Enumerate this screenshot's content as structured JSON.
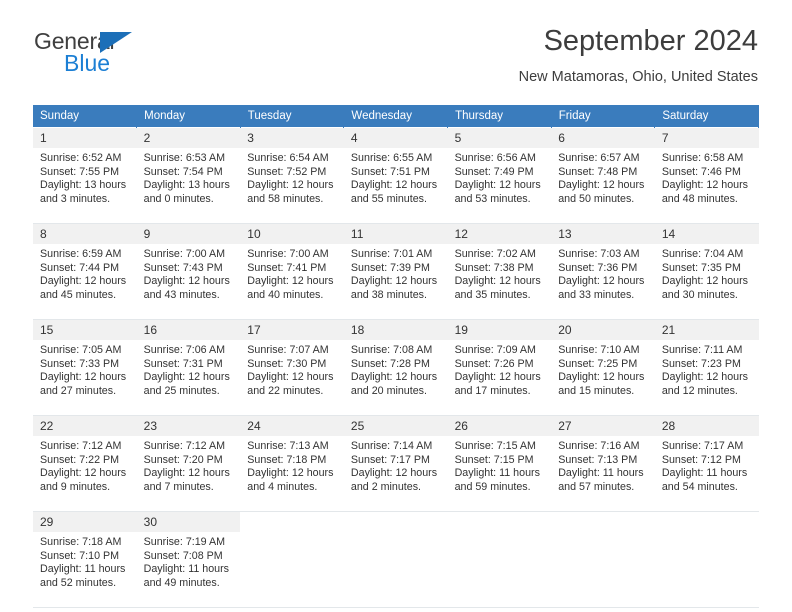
{
  "brand": {
    "name_top": "General",
    "name_bottom": "Blue",
    "accent_color": "#1c7fd4",
    "triangle_color": "#1c6fb8"
  },
  "header": {
    "title": "September 2024",
    "subtitle": "New Matamoras, Ohio, United States"
  },
  "theme": {
    "header_bg": "#3a7cbd",
    "daynum_bg": "#f1f1f1",
    "text": "#333333"
  },
  "weekdays": [
    "Sunday",
    "Monday",
    "Tuesday",
    "Wednesday",
    "Thursday",
    "Friday",
    "Saturday"
  ],
  "weeks": [
    {
      "days": [
        {
          "num": "1",
          "sunrise": "Sunrise: 6:52 AM",
          "sunset": "Sunset: 7:55 PM",
          "daylight1": "Daylight: 13 hours",
          "daylight2": "and 3 minutes."
        },
        {
          "num": "2",
          "sunrise": "Sunrise: 6:53 AM",
          "sunset": "Sunset: 7:54 PM",
          "daylight1": "Daylight: 13 hours",
          "daylight2": "and 0 minutes."
        },
        {
          "num": "3",
          "sunrise": "Sunrise: 6:54 AM",
          "sunset": "Sunset: 7:52 PM",
          "daylight1": "Daylight: 12 hours",
          "daylight2": "and 58 minutes."
        },
        {
          "num": "4",
          "sunrise": "Sunrise: 6:55 AM",
          "sunset": "Sunset: 7:51 PM",
          "daylight1": "Daylight: 12 hours",
          "daylight2": "and 55 minutes."
        },
        {
          "num": "5",
          "sunrise": "Sunrise: 6:56 AM",
          "sunset": "Sunset: 7:49 PM",
          "daylight1": "Daylight: 12 hours",
          "daylight2": "and 53 minutes."
        },
        {
          "num": "6",
          "sunrise": "Sunrise: 6:57 AM",
          "sunset": "Sunset: 7:48 PM",
          "daylight1": "Daylight: 12 hours",
          "daylight2": "and 50 minutes."
        },
        {
          "num": "7",
          "sunrise": "Sunrise: 6:58 AM",
          "sunset": "Sunset: 7:46 PM",
          "daylight1": "Daylight: 12 hours",
          "daylight2": "and 48 minutes."
        }
      ]
    },
    {
      "days": [
        {
          "num": "8",
          "sunrise": "Sunrise: 6:59 AM",
          "sunset": "Sunset: 7:44 PM",
          "daylight1": "Daylight: 12 hours",
          "daylight2": "and 45 minutes."
        },
        {
          "num": "9",
          "sunrise": "Sunrise: 7:00 AM",
          "sunset": "Sunset: 7:43 PM",
          "daylight1": "Daylight: 12 hours",
          "daylight2": "and 43 minutes."
        },
        {
          "num": "10",
          "sunrise": "Sunrise: 7:00 AM",
          "sunset": "Sunset: 7:41 PM",
          "daylight1": "Daylight: 12 hours",
          "daylight2": "and 40 minutes."
        },
        {
          "num": "11",
          "sunrise": "Sunrise: 7:01 AM",
          "sunset": "Sunset: 7:39 PM",
          "daylight1": "Daylight: 12 hours",
          "daylight2": "and 38 minutes."
        },
        {
          "num": "12",
          "sunrise": "Sunrise: 7:02 AM",
          "sunset": "Sunset: 7:38 PM",
          "daylight1": "Daylight: 12 hours",
          "daylight2": "and 35 minutes."
        },
        {
          "num": "13",
          "sunrise": "Sunrise: 7:03 AM",
          "sunset": "Sunset: 7:36 PM",
          "daylight1": "Daylight: 12 hours",
          "daylight2": "and 33 minutes."
        },
        {
          "num": "14",
          "sunrise": "Sunrise: 7:04 AM",
          "sunset": "Sunset: 7:35 PM",
          "daylight1": "Daylight: 12 hours",
          "daylight2": "and 30 minutes."
        }
      ]
    },
    {
      "days": [
        {
          "num": "15",
          "sunrise": "Sunrise: 7:05 AM",
          "sunset": "Sunset: 7:33 PM",
          "daylight1": "Daylight: 12 hours",
          "daylight2": "and 27 minutes."
        },
        {
          "num": "16",
          "sunrise": "Sunrise: 7:06 AM",
          "sunset": "Sunset: 7:31 PM",
          "daylight1": "Daylight: 12 hours",
          "daylight2": "and 25 minutes."
        },
        {
          "num": "17",
          "sunrise": "Sunrise: 7:07 AM",
          "sunset": "Sunset: 7:30 PM",
          "daylight1": "Daylight: 12 hours",
          "daylight2": "and 22 minutes."
        },
        {
          "num": "18",
          "sunrise": "Sunrise: 7:08 AM",
          "sunset": "Sunset: 7:28 PM",
          "daylight1": "Daylight: 12 hours",
          "daylight2": "and 20 minutes."
        },
        {
          "num": "19",
          "sunrise": "Sunrise: 7:09 AM",
          "sunset": "Sunset: 7:26 PM",
          "daylight1": "Daylight: 12 hours",
          "daylight2": "and 17 minutes."
        },
        {
          "num": "20",
          "sunrise": "Sunrise: 7:10 AM",
          "sunset": "Sunset: 7:25 PM",
          "daylight1": "Daylight: 12 hours",
          "daylight2": "and 15 minutes."
        },
        {
          "num": "21",
          "sunrise": "Sunrise: 7:11 AM",
          "sunset": "Sunset: 7:23 PM",
          "daylight1": "Daylight: 12 hours",
          "daylight2": "and 12 minutes."
        }
      ]
    },
    {
      "days": [
        {
          "num": "22",
          "sunrise": "Sunrise: 7:12 AM",
          "sunset": "Sunset: 7:22 PM",
          "daylight1": "Daylight: 12 hours",
          "daylight2": "and 9 minutes."
        },
        {
          "num": "23",
          "sunrise": "Sunrise: 7:12 AM",
          "sunset": "Sunset: 7:20 PM",
          "daylight1": "Daylight: 12 hours",
          "daylight2": "and 7 minutes."
        },
        {
          "num": "24",
          "sunrise": "Sunrise: 7:13 AM",
          "sunset": "Sunset: 7:18 PM",
          "daylight1": "Daylight: 12 hours",
          "daylight2": "and 4 minutes."
        },
        {
          "num": "25",
          "sunrise": "Sunrise: 7:14 AM",
          "sunset": "Sunset: 7:17 PM",
          "daylight1": "Daylight: 12 hours",
          "daylight2": "and 2 minutes."
        },
        {
          "num": "26",
          "sunrise": "Sunrise: 7:15 AM",
          "sunset": "Sunset: 7:15 PM",
          "daylight1": "Daylight: 11 hours",
          "daylight2": "and 59 minutes."
        },
        {
          "num": "27",
          "sunrise": "Sunrise: 7:16 AM",
          "sunset": "Sunset: 7:13 PM",
          "daylight1": "Daylight: 11 hours",
          "daylight2": "and 57 minutes."
        },
        {
          "num": "28",
          "sunrise": "Sunrise: 7:17 AM",
          "sunset": "Sunset: 7:12 PM",
          "daylight1": "Daylight: 11 hours",
          "daylight2": "and 54 minutes."
        }
      ]
    },
    {
      "days": [
        {
          "num": "29",
          "sunrise": "Sunrise: 7:18 AM",
          "sunset": "Sunset: 7:10 PM",
          "daylight1": "Daylight: 11 hours",
          "daylight2": "and 52 minutes."
        },
        {
          "num": "30",
          "sunrise": "Sunrise: 7:19 AM",
          "sunset": "Sunset: 7:08 PM",
          "daylight1": "Daylight: 11 hours",
          "daylight2": "and 49 minutes."
        },
        {
          "num": "",
          "sunrise": "",
          "sunset": "",
          "daylight1": "",
          "daylight2": ""
        },
        {
          "num": "",
          "sunrise": "",
          "sunset": "",
          "daylight1": "",
          "daylight2": ""
        },
        {
          "num": "",
          "sunrise": "",
          "sunset": "",
          "daylight1": "",
          "daylight2": ""
        },
        {
          "num": "",
          "sunrise": "",
          "sunset": "",
          "daylight1": "",
          "daylight2": ""
        },
        {
          "num": "",
          "sunrise": "",
          "sunset": "",
          "daylight1": "",
          "daylight2": ""
        }
      ]
    }
  ]
}
